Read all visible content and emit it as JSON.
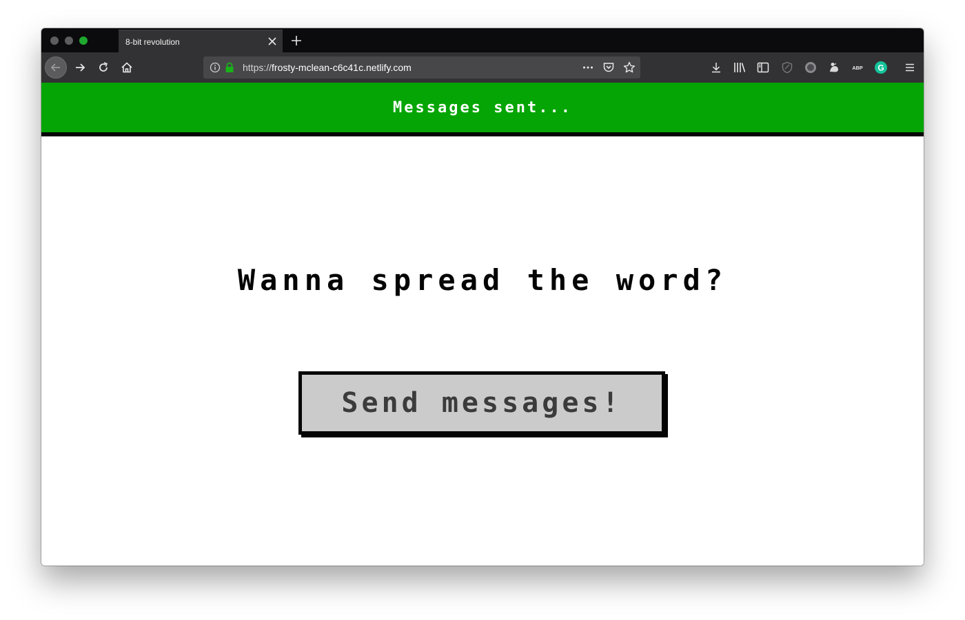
{
  "browser": {
    "tab_title": "8-bit revolution",
    "url": {
      "scheme": "https://",
      "host": "frosty-mclean-c6c41c.netlify.com"
    },
    "toolbar_icons": [
      "download-icon",
      "library-icon",
      "sidebar-icon",
      "shield-icon",
      "extension-circle-icon",
      "extension-bird-icon",
      "adblock-icon",
      "grammarly-icon",
      "hamburger-menu-icon"
    ],
    "adblock_label": "ABP",
    "grammarly_label": "G"
  },
  "page": {
    "status_message": "Messages sent...",
    "headline": "Wanna spread the word?",
    "send_button_label": "Send messages!"
  },
  "colors": {
    "status_bar": "#04a504",
    "button_bg": "#cbcbcb",
    "grammarly": "#15c39a"
  }
}
